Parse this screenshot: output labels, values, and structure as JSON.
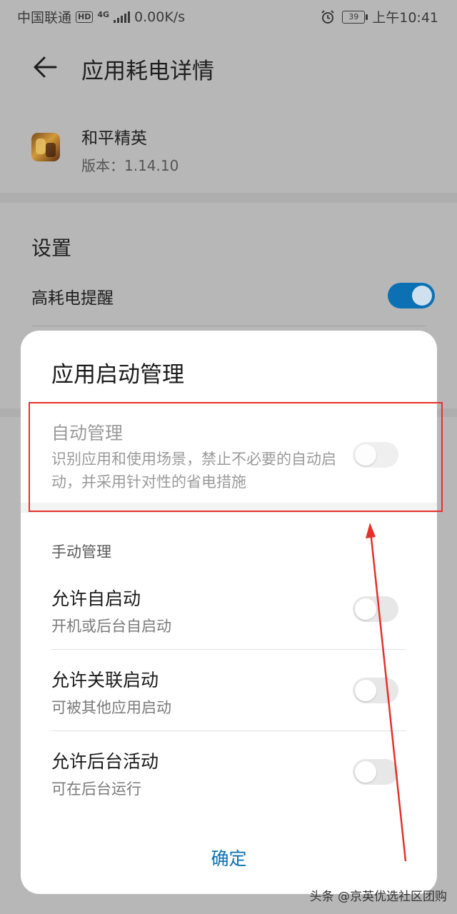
{
  "status_bar": {
    "carrier": "中国联通",
    "hd_badge": "HD",
    "net_type": "4G",
    "speed": "0.00K/s",
    "battery": "39",
    "time": "上午10:41"
  },
  "header": {
    "title": "应用耗电详情"
  },
  "app": {
    "name": "和平精英",
    "version": "版本：1.14.10"
  },
  "settings": {
    "section_title": "设置",
    "high_consumption_label": "高耗电提醒",
    "high_consumption_on": true
  },
  "dialog": {
    "title": "应用启动管理",
    "auto": {
      "title": "自动管理",
      "description": "识别应用和使用场景，禁止不必要的自动启动，并采用针对性的省电措施",
      "enabled": false
    },
    "manual_title": "手动管理",
    "items": [
      {
        "title": "允许自启动",
        "subtitle": "开机或后台自启动",
        "enabled": false
      },
      {
        "title": "允许关联启动",
        "subtitle": "可被其他应用启动",
        "enabled": false
      },
      {
        "title": "允许后台活动",
        "subtitle": "可在后台运行",
        "enabled": false
      }
    ],
    "confirm_label": "确定"
  },
  "watermark": "头条 @京英优选社区团购",
  "colors": {
    "accent": "#0a70b6",
    "toggle_on": "#0b71b4",
    "annotation_red": "#e4322b"
  }
}
